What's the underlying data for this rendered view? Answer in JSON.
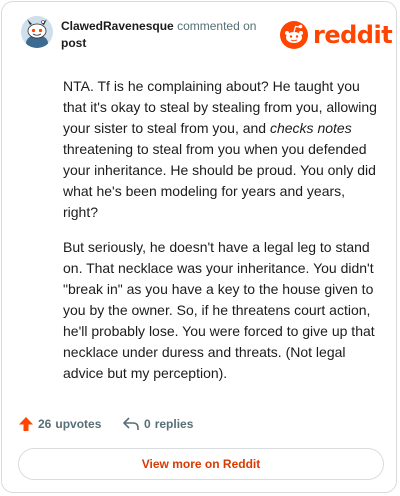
{
  "comment": {
    "username": "ClawedRavenesque",
    "action": "commented on",
    "target": "post",
    "paragraph1": {
      "part1": "NTA. Tf is he complaining about? He taught you that it's okay to steal by stealing from you, allowing your sister to steal from you, and ",
      "italic": "checks notes",
      "part2": " threatening to steal from you when you defended your inheritance. He should be proud. You only did what he's been modeling for years and years, right?"
    },
    "paragraph2": "But seriously, he doesn't have a legal leg to stand on. That necklace was your inheritance. You didn't \"break in\" as you have a key to the house given to you by the owner. So, if he threatens court action, he'll probably lose. You were forced to give up that necklace under duress and threats. (Not legal advice but my perception)."
  },
  "brand": {
    "name": "reddit",
    "color": "#ff4500"
  },
  "footer": {
    "upvotes_count": "26",
    "upvotes_label": "upvotes",
    "replies_count": "0",
    "replies_label": "replies"
  },
  "cta": {
    "label": "View more on Reddit",
    "color": "#d93a00"
  },
  "icons": [
    "avatar",
    "reddit-logo-icon",
    "upvote-arrow-icon",
    "reply-icon"
  ]
}
